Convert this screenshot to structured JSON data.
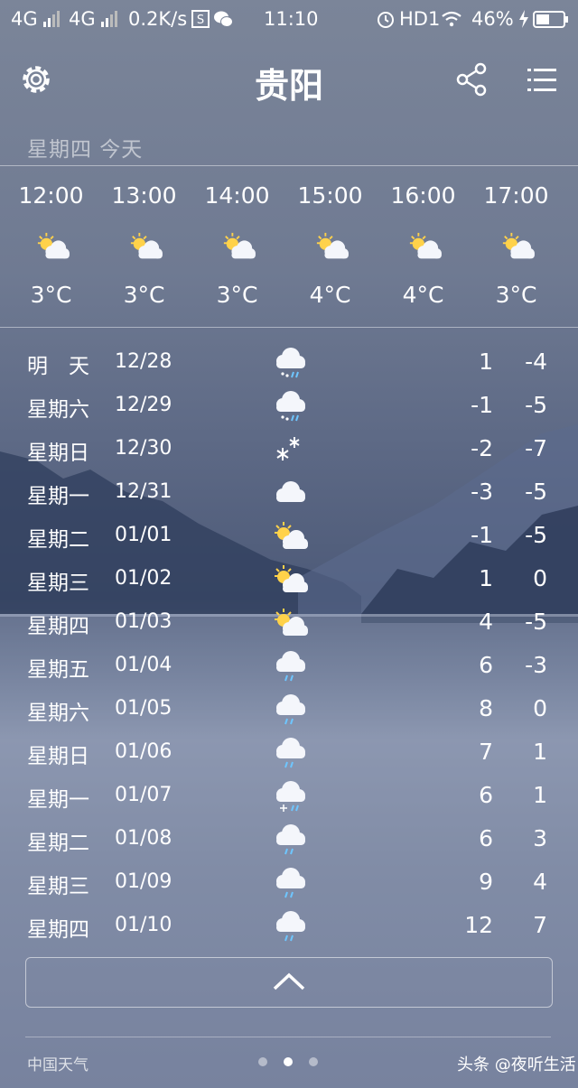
{
  "status_bar": {
    "network1": "4G",
    "network2": "4G",
    "speed": "0.2K/s",
    "time": "11:10",
    "hd": "HD1",
    "battery": "46%"
  },
  "header": {
    "city": "贵阳"
  },
  "day_label": "星期四   今天",
  "hourly": [
    {
      "time": "12:00",
      "temp": "3°C",
      "icon": "partly-cloudy-icon"
    },
    {
      "time": "13:00",
      "temp": "3°C",
      "icon": "partly-cloudy-icon"
    },
    {
      "time": "14:00",
      "temp": "3°C",
      "icon": "partly-cloudy-icon"
    },
    {
      "time": "15:00",
      "temp": "4°C",
      "icon": "partly-cloudy-icon"
    },
    {
      "time": "16:00",
      "temp": "4°C",
      "icon": "partly-cloudy-icon"
    },
    {
      "time": "17:00",
      "temp": "3°C",
      "icon": "partly-cloudy-icon"
    }
  ],
  "daily": [
    {
      "day": "明　天",
      "date": "12/28",
      "high": "1",
      "low": "-4",
      "icon": "sleet-icon"
    },
    {
      "day": "星期六",
      "date": "12/29",
      "high": "-1",
      "low": "-5",
      "icon": "sleet-icon"
    },
    {
      "day": "星期日",
      "date": "12/30",
      "high": "-2",
      "low": "-7",
      "icon": "snow-icon"
    },
    {
      "day": "星期一",
      "date": "12/31",
      "high": "-3",
      "low": "-5",
      "icon": "cloudy-icon"
    },
    {
      "day": "星期二",
      "date": "01/01",
      "high": "-1",
      "low": "-5",
      "icon": "partly-cloudy-icon"
    },
    {
      "day": "星期三",
      "date": "01/02",
      "high": "1",
      "low": "0",
      "icon": "partly-cloudy-icon"
    },
    {
      "day": "星期四",
      "date": "01/03",
      "high": "4",
      "low": "-5",
      "icon": "partly-cloudy-icon"
    },
    {
      "day": "星期五",
      "date": "01/04",
      "high": "6",
      "low": "-3",
      "icon": "rain-icon"
    },
    {
      "day": "星期六",
      "date": "01/05",
      "high": "8",
      "low": "0",
      "icon": "rain-icon"
    },
    {
      "day": "星期日",
      "date": "01/06",
      "high": "7",
      "low": "1",
      "icon": "rain-icon"
    },
    {
      "day": "星期一",
      "date": "01/07",
      "high": "6",
      "low": "1",
      "icon": "sleet-icon"
    },
    {
      "day": "星期二",
      "date": "01/08",
      "high": "6",
      "low": "3",
      "icon": "rain-icon"
    },
    {
      "day": "星期三",
      "date": "01/09",
      "high": "9",
      "low": "4",
      "icon": "rain-icon"
    },
    {
      "day": "星期四",
      "date": "01/10",
      "high": "12",
      "low": "7",
      "icon": "rain-icon"
    }
  ],
  "footer": {
    "source": "中国天气",
    "watermark": "头条 @夜听生活",
    "page_count": 3,
    "active_page": 2
  }
}
